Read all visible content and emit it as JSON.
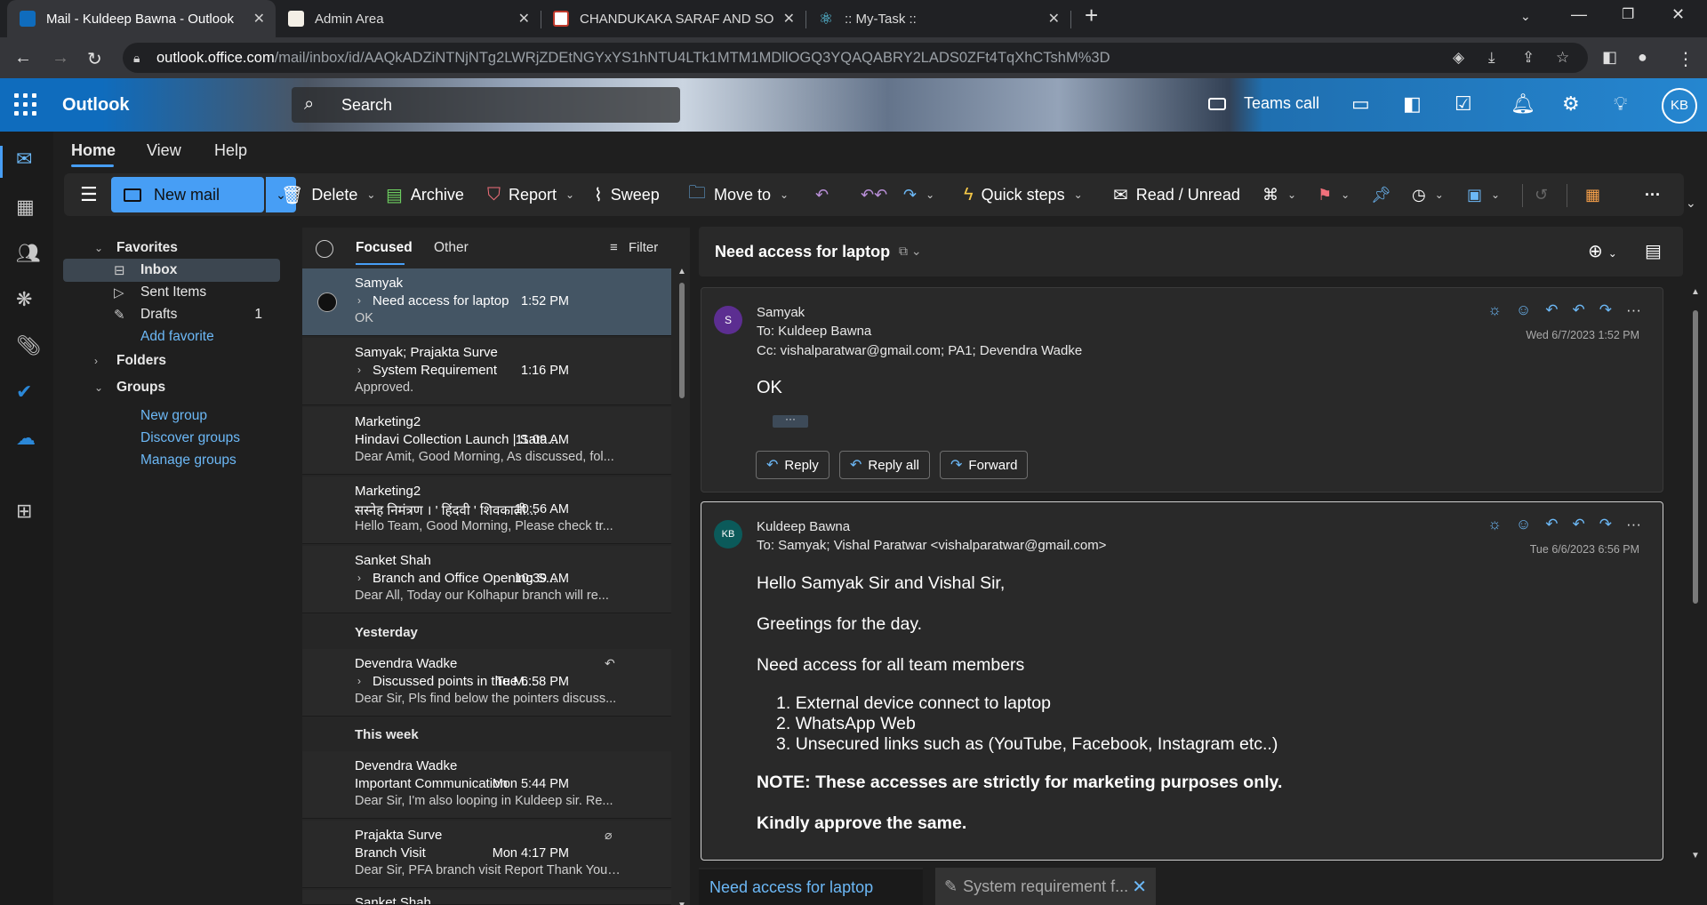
{
  "browser": {
    "tabs": [
      {
        "title": "Mail - Kuldeep Bawna - Outlook"
      },
      {
        "title": "Admin Area"
      },
      {
        "title": "CHANDUKAKA SARAF AND SONS"
      },
      {
        "title": ":: My-Task ::"
      }
    ],
    "url_host": "outlook.office.com",
    "url_path": "/mail/inbox/id/AAQkADZiNTNjNTg2LWRjZDEtNGYxYS1hNTU4LTk1MTM1MDllOGQ3YQAQABRY2LADS0ZFt4TqXhCTshM%3D"
  },
  "header": {
    "app_name": "Outlook",
    "search_placeholder": "Search",
    "teams_call": "Teams call",
    "avatar_initials": "KB"
  },
  "ribbon": {
    "tabs": [
      "Home",
      "View",
      "Help"
    ],
    "new_mail": "New mail",
    "delete": "Delete",
    "archive": "Archive",
    "report": "Report",
    "sweep": "Sweep",
    "move_to": "Move to",
    "quick_steps": "Quick steps",
    "read_unread": "Read / Unread"
  },
  "folders": {
    "favorites": "Favorites",
    "inbox": "Inbox",
    "sent": "Sent Items",
    "drafts": "Drafts",
    "drafts_count": "1",
    "add_favorite": "Add favorite",
    "folders": "Folders",
    "groups": "Groups",
    "new_group": "New group",
    "discover_groups": "Discover groups",
    "manage_groups": "Manage groups"
  },
  "list": {
    "focused": "Focused",
    "other": "Other",
    "filter": "Filter",
    "messages": [
      {
        "from": "Samyak",
        "subject": "Need access for laptop",
        "time": "1:52 PM",
        "preview": "OK"
      },
      {
        "from": "Samyak; Prajakta Surve",
        "subject": "System Requirement",
        "time": "1:16 PM",
        "preview": "Approved."
      },
      {
        "from": "Marketing2",
        "subject": "Hindavi Collection Launch | Sata...",
        "time": "11:09 AM",
        "preview": "Dear Amit, Good Morning, As discussed, fol..."
      },
      {
        "from": "Marketing2",
        "subject": "सस्नेह निमंत्रण । ' हिंदवी ' शिवकाली...",
        "time": "10:56 AM",
        "preview": "Hello Team, Good Morning, Please check tr..."
      },
      {
        "from": "Sanket Shah",
        "subject": "Branch and Office Opening S...",
        "time": "10:39 AM",
        "preview": "Dear All, Today our Kolhapur branch will re..."
      },
      {
        "from": "Devendra Wadke",
        "subject": "Discussed points in the M...",
        "time": "Tue 6:58 PM",
        "preview": "Dear Sir, Pls find below the pointers discuss..."
      },
      {
        "from": "Devendra Wadke",
        "subject": "Important Communication",
        "time": "Mon 5:44 PM",
        "preview": "Dear Sir, I'm also looping in Kuldeep sir. Re..."
      },
      {
        "from": "Prajakta Surve",
        "subject": "Branch Visit",
        "time": "Mon 4:17 PM",
        "preview": "Dear Sir, PFA branch visit Report Thank You ..."
      },
      {
        "from": "Sanket Shah"
      }
    ],
    "group_yesterday": "Yesterday",
    "group_this_week": "This week"
  },
  "reading": {
    "subject": "Need access for laptop",
    "msg1": {
      "avatar": "S",
      "avatar_color": "#5c2e91",
      "sender": "Samyak",
      "to": "To: Kuldeep Bawna",
      "cc": "Cc: vishalparatwar@gmail.com; PA1; Devendra Wadke",
      "date": "Wed 6/7/2023 1:52 PM",
      "body": "OK",
      "ellipsis": "···",
      "reply": "Reply",
      "reply_all": "Reply all",
      "forward": "Forward"
    },
    "msg2": {
      "avatar": "KB",
      "avatar_color": "#0b5a5a",
      "sender": "Kuldeep Bawna",
      "to": "To: Samyak; Vishal Paratwar <vishalparatwar@gmail.com>",
      "date": "Tue 6/6/2023 6:56 PM",
      "greeting": "Hello Samyak Sir and Vishal Sir,",
      "line1": "Greetings for the day.",
      "line2": "Need access for all team members",
      "items": [
        "External device connect to laptop",
        "WhatsApp Web",
        "Unsecured links such as (YouTube, Facebook, Instagram etc..)"
      ],
      "note": "NOTE: These accesses are strictly for marketing purposes only.",
      "approve": "Kindly approve the same."
    }
  },
  "bottom_tabs": {
    "tab1": "Need access for laptop",
    "tab2": "System requirement f..."
  },
  "colors": {
    "accent": "#479ef5",
    "link": "#6cb8f6",
    "selected_row": "#445564"
  }
}
